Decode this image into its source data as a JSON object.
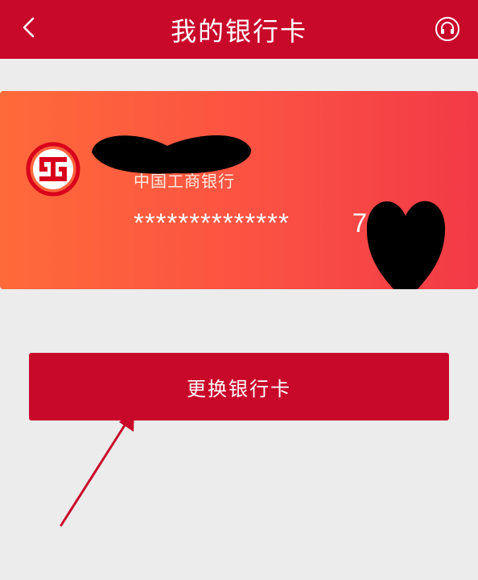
{
  "header": {
    "title": "我的银行卡",
    "back_icon": "chevron-left-icon",
    "service_icon": "customer-service-icon"
  },
  "card": {
    "bank_name": "中国工商银行",
    "number_masked": "**************",
    "number_suffix": "7",
    "logo_icon": "icbc-logo-icon"
  },
  "actions": {
    "change_card_label": "更换银行卡"
  },
  "colors": {
    "brand_red": "#c9092a",
    "card_gradient_start": "#ff6a3a",
    "card_gradient_end": "#f23a47",
    "background": "#ececec"
  }
}
